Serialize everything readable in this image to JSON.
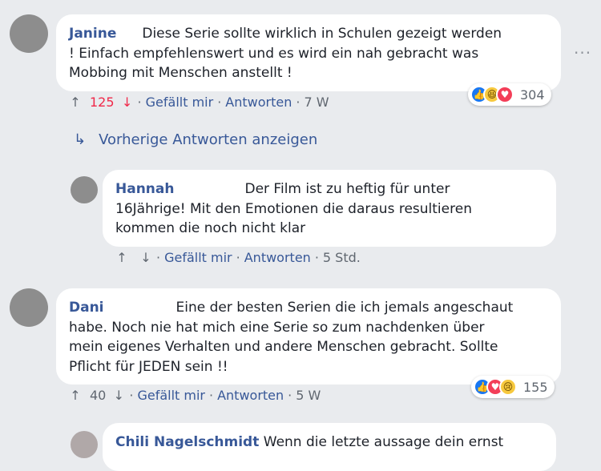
{
  "comments": [
    {
      "name": "Janine",
      "text1": "Diese Serie sollte wirklich in Schulen gezeigt werden",
      "text2": "! Einfach empfehlenswert und es wird ein nah gebracht was",
      "text3": "Mobbing mit Menschen anstellt !",
      "votes": "125",
      "like": "Gefällt mir",
      "reply": "Antworten",
      "time": "7 W",
      "reaction_count": "304"
    },
    {
      "name": "Hannah",
      "text1": "Der Film ist zu heftig für unter",
      "text2": "16Jährige! Mit den Emotionen die daraus resultieren",
      "text3": "kommen die noch nicht klar",
      "like": "Gefällt mir",
      "reply": "Antworten",
      "time": "5 Std."
    },
    {
      "name": "Dani",
      "text1": "Eine der besten Serien die ich jemals angeschaut",
      "text2": "habe. Noch nie hat mich eine Serie so zum nachdenken über",
      "text3": "mein eigenes Verhalten und andere Menschen gebracht. Sollte",
      "text4": "Pflicht für JEDEN sein !!",
      "votes": "40",
      "like": "Gefällt mir",
      "reply": "Antworten",
      "time": "5 W",
      "reaction_count": "155"
    },
    {
      "name": "Chili Nagelschmidt",
      "text1": "Wenn die letzte aussage dein ernst"
    }
  ],
  "previous_replies": "Vorherige Antworten anzeigen",
  "icons": {
    "up": "arrow-up-icon",
    "down": "arrow-down-icon",
    "reply": "reply-arrow-icon",
    "more": "more-options-icon"
  },
  "colors": {
    "link": "#385898",
    "upvote": "#f02849",
    "background": "#e9ebee"
  }
}
